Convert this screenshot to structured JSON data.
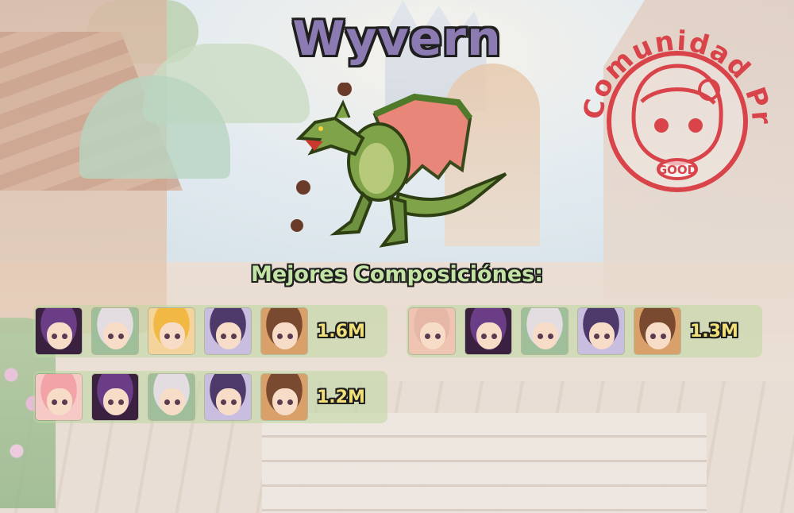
{
  "boss": {
    "name": "Wyvern",
    "icon": "wyvern-boss-icon"
  },
  "stamp": {
    "text": "Comunidad Princessa",
    "badge": "GOOD",
    "color": "#d9444a"
  },
  "section_title": "Mejores Composiciónes:",
  "colors": {
    "title_fill": "#8c7bb2",
    "subtitle_fill": "#c2e3a4",
    "score_fill": "#f1e07a",
    "row_bg": "rgba(190,215,160,0.55)"
  },
  "compositions": [
    {
      "damage": "1.6M",
      "units": [
        {
          "icon": "character-purple-hair-eyepatch-icon",
          "hair": "#6b3d86",
          "bg": "#3a2140"
        },
        {
          "icon": "character-white-hair-flower-icon",
          "hair": "#e3dde2",
          "bg": "#9fbf9a"
        },
        {
          "icon": "character-blonde-fox-icon",
          "hair": "#f2b844",
          "bg": "#f5d49b"
        },
        {
          "icon": "character-purple-hair-horns-icon",
          "hair": "#4d3a6a",
          "bg": "#c9bde0"
        },
        {
          "icon": "character-brown-hair-smile-icon",
          "hair": "#7a4a30",
          "bg": "#d9a06a"
        }
      ]
    },
    {
      "damage": "1.3M",
      "units": [
        {
          "icon": "character-pink-hair-elf-icon",
          "hair": "#e7b7a6",
          "bg": "#efc4b0"
        },
        {
          "icon": "character-purple-hair-eyepatch-icon",
          "hair": "#6b3d86",
          "bg": "#3a2140"
        },
        {
          "icon": "character-white-hair-flower-icon",
          "hair": "#e3dde2",
          "bg": "#9fbf9a"
        },
        {
          "icon": "character-purple-hair-horns-icon",
          "hair": "#4d3a6a",
          "bg": "#c9bde0"
        },
        {
          "icon": "character-brown-hair-smile-icon",
          "hair": "#7a4a30",
          "bg": "#d9a06a"
        }
      ]
    },
    {
      "damage": "1.2M",
      "units": [
        {
          "icon": "character-pink-hair-wink-icon",
          "hair": "#f2a3a8",
          "bg": "#f7c9c6"
        },
        {
          "icon": "character-purple-hair-eyepatch-icon",
          "hair": "#6b3d86",
          "bg": "#3a2140"
        },
        {
          "icon": "character-white-hair-flower-icon",
          "hair": "#e3dde2",
          "bg": "#9fbf9a"
        },
        {
          "icon": "character-purple-hair-horns-icon",
          "hair": "#4d3a6a",
          "bg": "#c9bde0"
        },
        {
          "icon": "character-brown-hair-smile-icon",
          "hair": "#7a4a30",
          "bg": "#d9a06a"
        }
      ]
    }
  ]
}
